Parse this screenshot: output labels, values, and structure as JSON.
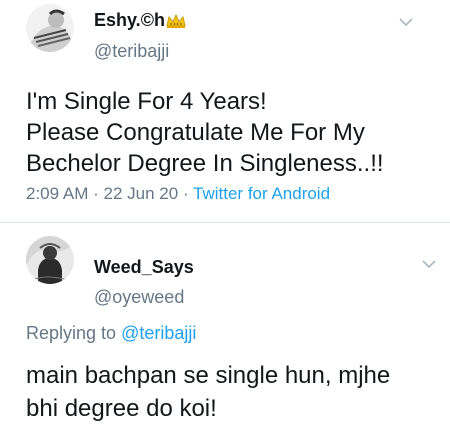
{
  "tweet1": {
    "display_name": "Eshy.©h",
    "username": "@teribajji",
    "text_lines": [
      "I'm Single For 4 Years!",
      "Please Congratulate Me For My",
      "Bechelor Degree In Singleness..!!"
    ],
    "time": "2:09 AM",
    "date": "22 Jun 20",
    "source": "Twitter for Android",
    "separator": "·",
    "name_icon": "crown-icon"
  },
  "tweet2": {
    "display_name": "Weed_Says",
    "username": "@oyeweed",
    "replying_prefix": "Replying to",
    "replying_to": "@teribajji",
    "text_lines": [
      "main bachpan se single hun, mjhe",
      "bhi degree do koi!"
    ]
  },
  "colors": {
    "link": "#1da1f2",
    "secondary_text": "#657786",
    "primary_text": "#14171a",
    "divider": "#e1e8ed",
    "crown": "#f5c518"
  },
  "icons": {
    "menu": "chevron-down-icon"
  }
}
